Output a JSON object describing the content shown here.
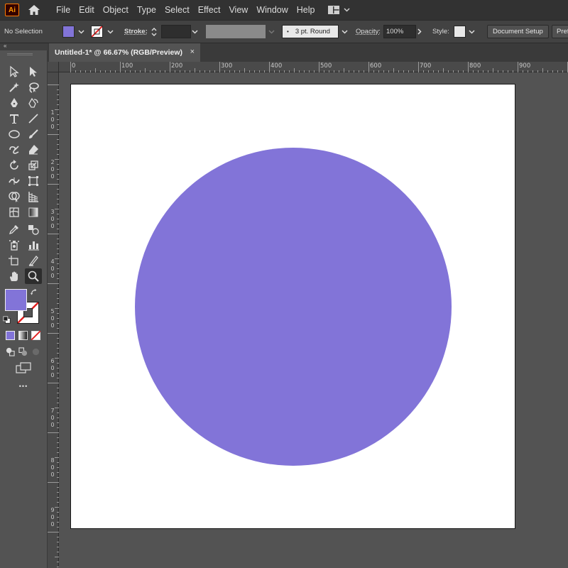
{
  "app": {
    "logo_text": "Ai"
  },
  "menu": [
    "File",
    "Edit",
    "Object",
    "Type",
    "Select",
    "Effect",
    "View",
    "Window",
    "Help"
  ],
  "control_bar": {
    "selection_status": "No Selection",
    "stroke_label": "Stroke:",
    "brush_label": "3 pt. Round",
    "opacity_label": "Opacity:",
    "opacity_value": "100%",
    "style_label": "Style:",
    "document_setup": "Document Setup",
    "preferences": "Pref"
  },
  "document_tab": {
    "title": "Untitled-1* @ 66.67% (RGB/Preview)",
    "close": "×"
  },
  "ruler": {
    "horizontal": [
      "0",
      "100",
      "200",
      "300",
      "400",
      "500",
      "600",
      "700",
      "800",
      "900"
    ],
    "vertical": [
      "1\n0\n0",
      "2\n0\n0",
      "3\n0\n0",
      "4\n0\n0",
      "5\n0\n0",
      "6\n0\n0",
      "7\n0\n0",
      "8\n0\n0",
      "9\n0\n0"
    ]
  },
  "colors": {
    "fill": "#8274d8",
    "stroke": "none",
    "menubar_bg": "#323232",
    "controlbar_bg": "#424242",
    "workspace_bg": "#535353"
  },
  "artwork": {
    "shape": "circle",
    "fill": "#8274d8"
  },
  "tools": [
    "selection-tool-icon",
    "direct-selection-tool-icon",
    "magic-wand-tool-icon",
    "lasso-tool-icon",
    "pen-tool-icon",
    "curvature-tool-icon",
    "type-tool-icon",
    "line-segment-tool-icon",
    "ellipse-tool-icon",
    "paintbrush-tool-icon",
    "shaper-tool-icon",
    "eraser-tool-icon",
    "rotate-tool-icon",
    "scale-tool-icon",
    "width-tool-icon",
    "free-transform-tool-icon",
    "shape-builder-tool-icon",
    "perspective-grid-tool-icon",
    "mesh-tool-icon",
    "gradient-tool-icon",
    "eyedropper-tool-icon",
    "blend-tool-icon",
    "symbol-sprayer-tool-icon",
    "column-graph-tool-icon",
    "artboard-tool-icon",
    "slice-tool-icon",
    "hand-tool-icon",
    "zoom-tool-icon"
  ],
  "more_tools": "•••"
}
